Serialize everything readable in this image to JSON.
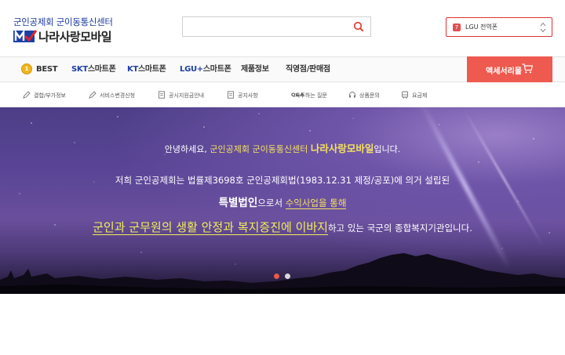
{
  "header": {
    "logo_top": "군인공제회 군이동통신센터",
    "logo_name": "나라사랑모바일",
    "search_placeholder": "",
    "carrier": {
      "badge": "7",
      "label": "LGU 전역폰"
    }
  },
  "nav": {
    "items": [
      {
        "label": "BEST"
      },
      {
        "brand": "SKT",
        "label": "스마트폰"
      },
      {
        "brand": "KT",
        "label": "스마트폰"
      },
      {
        "brand": "LGU+",
        "label": "스마트폰"
      },
      {
        "label": "제품정보"
      },
      {
        "label": "직영점/판매점"
      }
    ],
    "accessory_label": "액세서리몰"
  },
  "subnav": {
    "items": [
      {
        "label": "결합/부가정보",
        "icon": "edit-icon"
      },
      {
        "label": "서비스변경신청",
        "icon": "edit-icon"
      },
      {
        "label": "공시지원금안내",
        "icon": "document-icon"
      },
      {
        "label": "공지사항",
        "icon": "document-icon"
      },
      {
        "tag": "Q&A",
        "label": "자주하는 질문",
        "icon": "qa-icon"
      },
      {
        "label": "상품문의",
        "icon": "headset-icon"
      },
      {
        "label": "요금제",
        "icon": "bus-icon"
      }
    ]
  },
  "banner": {
    "line1": {
      "pre": "안녕하세요, ",
      "org": "군인공제회 군이동통신센터",
      "brand": "나라사랑모바일",
      "post": "입니다."
    },
    "line2": "저희 군인공제회는 법률제3698호 군인공제회법(1983.12.31 제정/공포)에 의거 설립된",
    "line3": {
      "bold": "특별법인",
      "mid": "으로서 ",
      "hl": "수익사업을 통해"
    },
    "line4": {
      "hl": "군인과 군무원의 생활 안정과 복지증진에 이바지",
      "post": "하고 있는 국군의 종합복지기관입니다."
    }
  },
  "colors": {
    "accent": "#ee5a4f",
    "brand_blue": "#1b3fa5",
    "highlight": "#f4e160"
  }
}
